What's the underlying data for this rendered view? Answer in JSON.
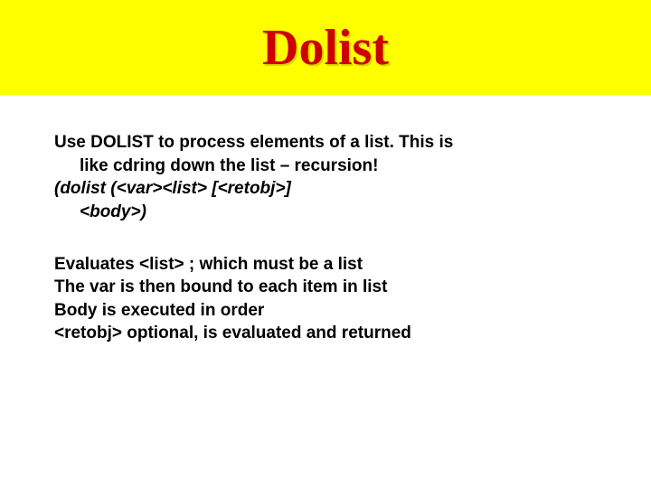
{
  "title": "Dolist",
  "para1": {
    "line1": "Use DOLIST to process elements of a list.  This is",
    "line2": "like cdring down the list – recursion!",
    "line3": "(dolist (<var><list> [<retobj>]",
    "line4": "<body>)"
  },
  "para2": {
    "line1": "Evaluates <list> ; which must be a list",
    "line2": "The var is then bound to each item in list",
    "line3": "Body is executed in order",
    "line4": "<retobj> optional, is evaluated and returned"
  }
}
